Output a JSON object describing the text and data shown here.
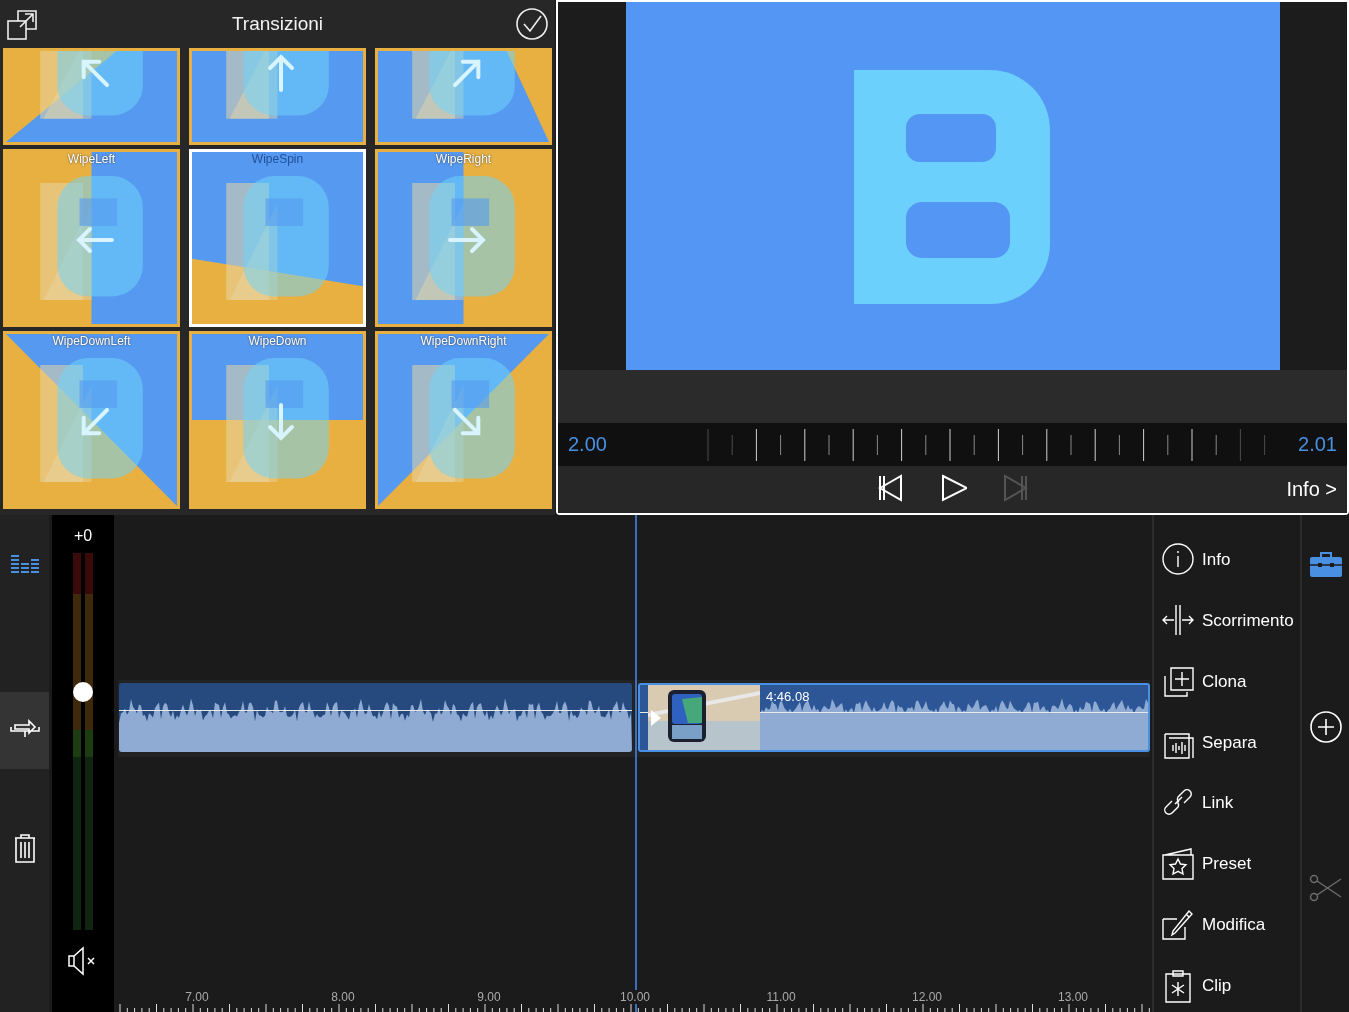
{
  "transitions_panel": {
    "title": "Transizioni",
    "items": [
      {
        "selected": false
      },
      {
        "selected": false
      },
      {
        "selected": false
      },
      {
        "label": "WipeLeft",
        "selected": false
      },
      {
        "label": "WipeSpin",
        "selected": true
      },
      {
        "label": "WipeRight",
        "selected": false
      },
      {
        "label": "WipeDownLeft",
        "selected": false
      },
      {
        "label": "WipeDown",
        "selected": false
      },
      {
        "label": "WipeDownRight",
        "selected": false
      }
    ]
  },
  "preview": {
    "start_time": "2.00",
    "end_time": "2.01",
    "controls": [
      {
        "kind": "previous",
        "disabled": false
      },
      {
        "kind": "play",
        "disabled": false
      },
      {
        "kind": "next",
        "disabled": true
      }
    ],
    "info_link": "Info >"
  },
  "track_tools": [
    {
      "kind": "levels",
      "active": true,
      "selected": false
    },
    {
      "kind": "route",
      "active": false,
      "selected": true
    },
    {
      "kind": "delete",
      "active": false,
      "selected": false
    }
  ],
  "meter": {
    "reading": "+0",
    "level": 0.63
  },
  "timeline": {
    "clips": [
      {
        "kind": "audio",
        "selected": false
      },
      {
        "kind": "video",
        "selected": true,
        "duration": "4:46.08"
      }
    ],
    "ruler": [
      "7.00",
      "8.00",
      "9.00",
      "10.00",
      "11.00",
      "12.00",
      "13.00"
    ]
  },
  "actions": [
    {
      "kind": "info",
      "label": "Info"
    },
    {
      "kind": "slide",
      "label": "Scorrimento"
    },
    {
      "kind": "clone",
      "label": "Clona"
    },
    {
      "kind": "split",
      "label": "Separa"
    },
    {
      "kind": "link",
      "label": "Link"
    },
    {
      "kind": "preset",
      "label": "Preset"
    },
    {
      "kind": "edit",
      "label": "Modifica"
    },
    {
      "kind": "clip",
      "label": "Clip"
    }
  ],
  "side_tools": [
    {
      "kind": "toolbox",
      "selected": true,
      "disabled": false
    },
    {
      "kind": "add",
      "selected": false,
      "disabled": false
    },
    {
      "kind": "cut",
      "selected": false,
      "disabled": true
    }
  ]
}
